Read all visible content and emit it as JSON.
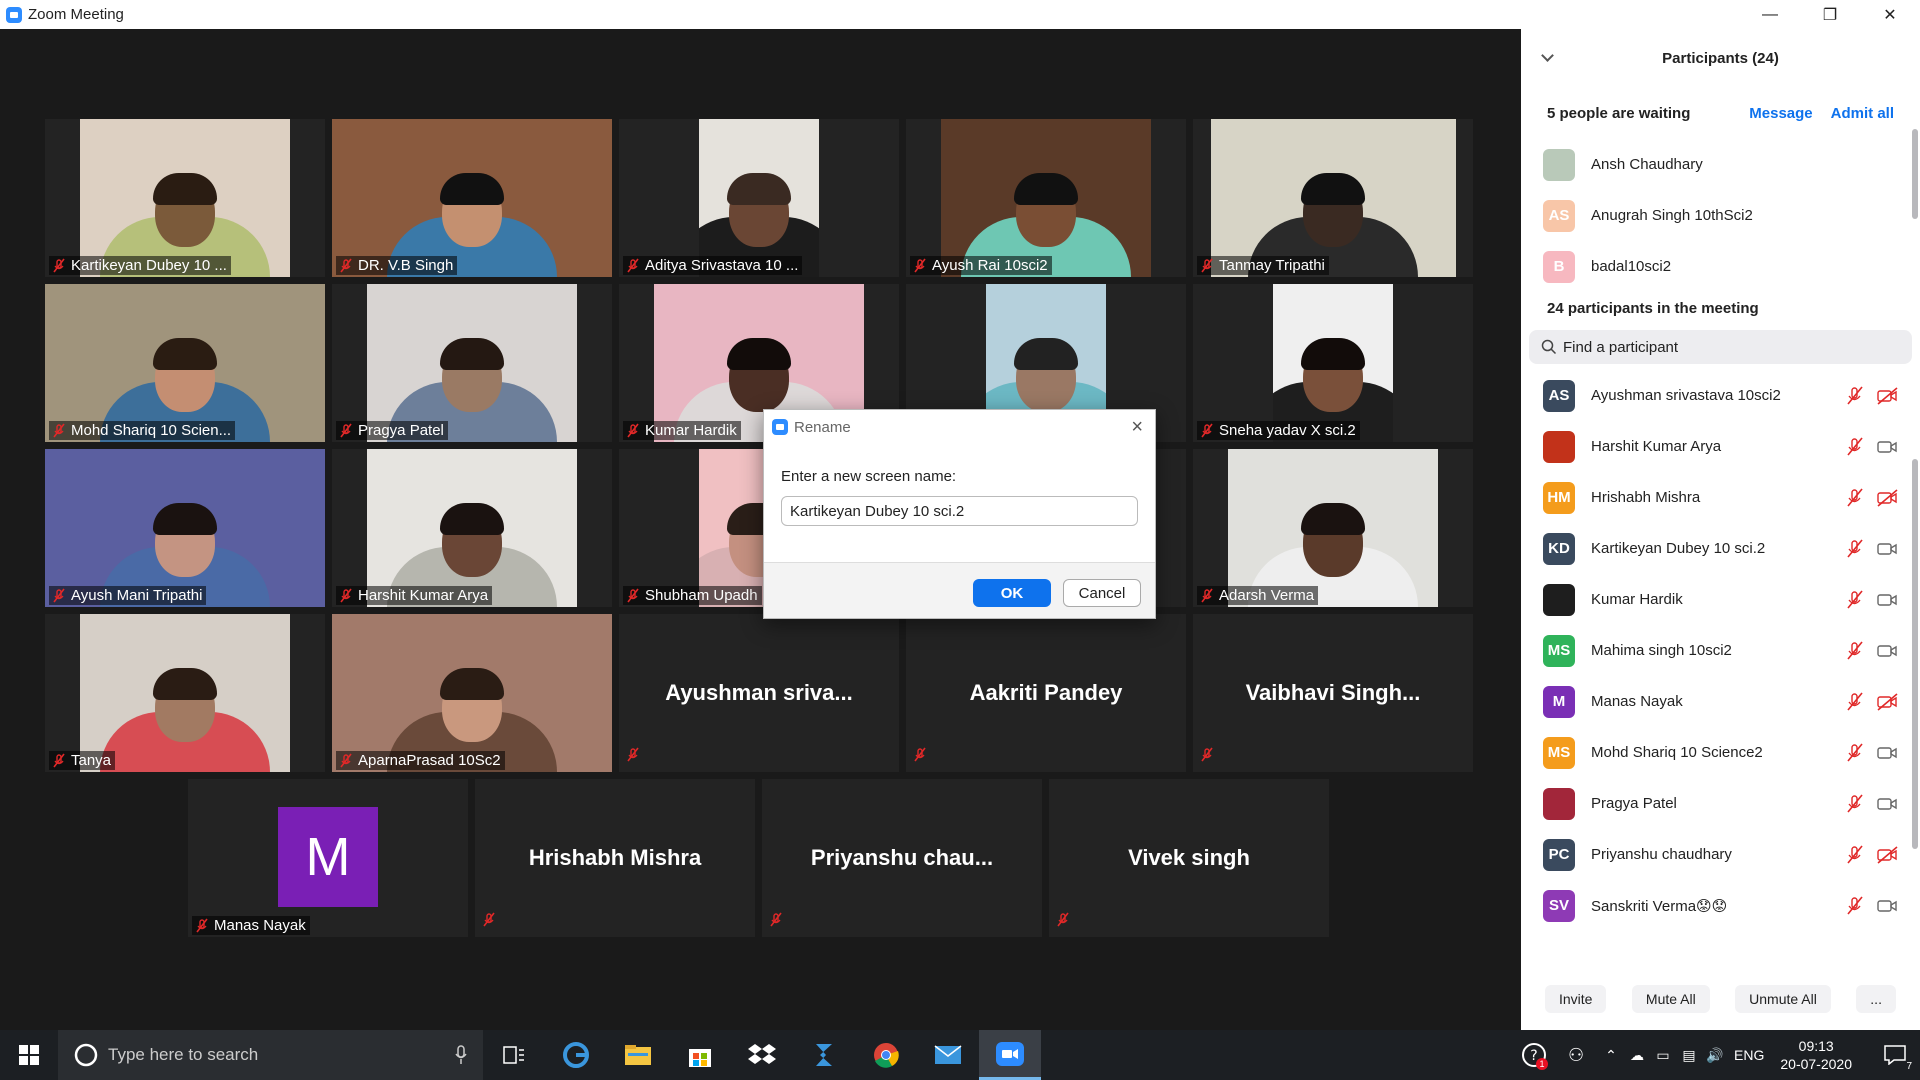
{
  "window": {
    "title": "Zoom Meeting"
  },
  "tiles": [
    {
      "name": "Kartikeyan Dubey 10 ...",
      "colors": [
        "#ddd0c2",
        "#7b5a3a",
        "#b6c07a",
        "#2a1c12"
      ]
    },
    {
      "name": "DR. V.B Singh",
      "colors": [
        "#8a5a3e",
        "#c49070",
        "#3a79a8",
        "#111"
      ]
    },
    {
      "name": "Aditya Srivastava 10 ...",
      "colors": [
        "#e5e2dc",
        "#6a4634",
        "#1c1c1c",
        "#3a2a22"
      ]
    },
    {
      "name": "Ayush Rai 10sci2",
      "colors": [
        "#5a3a28",
        "#7a4e34",
        "#6ec7b3",
        "#111"
      ]
    },
    {
      "name": "Tanmay Tripathi",
      "colors": [
        "#d7d4c6",
        "#3a2a22",
        "#2a2a2a",
        "#111"
      ]
    },
    {
      "name": "Mohd Shariq 10 Scien...",
      "colors": [
        "#a0947c",
        "#c48e72",
        "#3d6f9a",
        "#2a1c12"
      ]
    },
    {
      "name": "Pragya Patel",
      "colors": [
        "#d8d4d2",
        "#9a7a64",
        "#6d7f9a",
        "#241812"
      ]
    },
    {
      "name": "Kumar Hardik",
      "colors": [
        "#e8b6c2",
        "#4a2e24",
        "#ddd8d8",
        "#120c0a"
      ]
    },
    {
      "name": "",
      "colors": [
        "#b5d0dc",
        "#9a7864",
        "#6cb8c4",
        "#222"
      ]
    },
    {
      "name": "Sneha yadav X sci.2",
      "colors": [
        "#efefef",
        "#7a503a",
        "#1e1e1e",
        "#120c0a"
      ]
    },
    {
      "name": "Ayush Mani Tripathi",
      "colors": [
        "#5b5fa0",
        "#c49482",
        "#4a6aa6",
        "#1a1210"
      ]
    },
    {
      "name": "Harshit Kumar Arya",
      "colors": [
        "#e6e4e0",
        "#6a4636",
        "#b6b6ae",
        "#1a1210"
      ]
    },
    {
      "name": "Shubham Upadh",
      "colors": [
        "#f0c0c2",
        "#c49080",
        "#d8b0b2",
        "#2a1e18"
      ]
    },
    {
      "name": "",
      "colors": [
        "#333",
        "#333",
        "#333",
        "#333"
      ]
    },
    {
      "name": "Adarsh Verma",
      "colors": [
        "#e0e0dc",
        "#5a3a2a",
        "#eeeeee",
        "#1a1210"
      ]
    },
    {
      "name": "Tanya",
      "colors": [
        "#d6cfc7",
        "#a27a62",
        "#d74d53",
        "#2a1c14"
      ]
    },
    {
      "name": "AparnaPrasad 10Sc2",
      "colors": [
        "#a27a6a",
        "#c9987e",
        "#6a4a3a",
        "#2a1c14"
      ]
    }
  ],
  "name_tiles": [
    "Ayushman  sriva...",
    "Aakriti Pandey",
    "Vaibhavi  Singh...",
    "",
    "Hrishabh Mishra",
    "Priyanshu  chau...",
    "Vivek singh"
  ],
  "manas_tile": {
    "initial": "M",
    "name": "Manas Nayak"
  },
  "panel": {
    "title": "Participants (24)",
    "waiting": {
      "text": "5 people are waiting",
      "message": "Message",
      "admit_all": "Admit all",
      "list": [
        {
          "initials": "",
          "name": "Ansh Chaudhary",
          "color": "#b9c9b9"
        },
        {
          "initials": "AS",
          "name": "Anugrah Singh 10thSci2",
          "color": "#f8c6a8"
        },
        {
          "initials": "B",
          "name": "badal10sci2",
          "color": "#f7b8c0"
        }
      ]
    },
    "in_meeting": "24 participants in the meeting",
    "search_placeholder": "Find a participant",
    "participants": [
      {
        "initials": "AS",
        "name": "Ayushman srivastava 10sci2",
        "color": "#3a4a5e",
        "video_off": true
      },
      {
        "initials": "",
        "name": "Harshit Kumar Arya",
        "color": "#c2321a",
        "video_off": false
      },
      {
        "initials": "HM",
        "name": "Hrishabh Mishra",
        "color": "#f49c1c",
        "video_off": true
      },
      {
        "initials": "KD",
        "name": "Kartikeyan Dubey 10 sci.2",
        "color": "#3a4a5e",
        "video_off": false
      },
      {
        "initials": "",
        "name": "Kumar Hardik",
        "color": "#1e1e1e",
        "video_off": false
      },
      {
        "initials": "MS",
        "name": "Mahima singh 10sci2",
        "color": "#2fb35a",
        "video_off": false
      },
      {
        "initials": "M",
        "name": "Manas Nayak",
        "color": "#7a2fb5",
        "video_off": true
      },
      {
        "initials": "MS",
        "name": "Mohd Shariq 10 Science2",
        "color": "#f49c1c",
        "video_off": false
      },
      {
        "initials": "",
        "name": "Pragya Patel",
        "color": "#a2263a",
        "video_off": false
      },
      {
        "initials": "PC",
        "name": "Priyanshu chaudhary",
        "color": "#3a4a5e",
        "video_off": true
      },
      {
        "initials": "SV",
        "name": "Sanskriti Verma😟😟",
        "color": "#8e3ab5",
        "video_off": false
      }
    ],
    "footer": {
      "invite": "Invite",
      "mute_all": "Mute All",
      "unmute_all": "Unmute All",
      "more": "..."
    }
  },
  "dialog": {
    "title": "Rename",
    "label": "Enter a new screen name:",
    "value": "Kartikeyan Dubey 10 sci.2",
    "ok": "OK",
    "cancel": "Cancel"
  },
  "taskbar": {
    "search_placeholder": "Type here to search",
    "lang": "ENG",
    "time": "09:13",
    "date": "20-07-2020",
    "notif_count": "7",
    "help_badge": "1"
  }
}
